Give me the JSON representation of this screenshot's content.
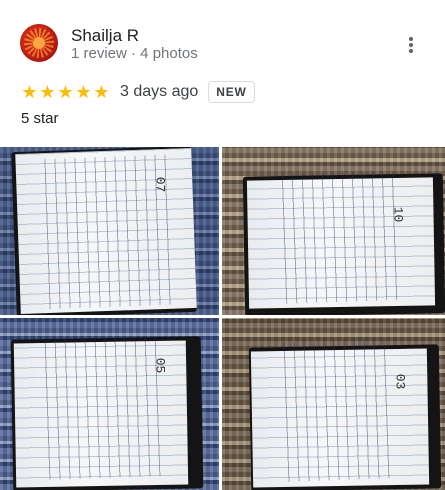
{
  "reviewer": {
    "name": "Shailja R",
    "stats": "1 review · 4 photos",
    "avatar_icon": "avatar-photo-icon"
  },
  "menu": {
    "icon": "more-vert-icon"
  },
  "rating": {
    "stars": 5,
    "max_stars": 5,
    "star_color": "#fbbc04",
    "time": "3 days ago",
    "badge": "NEW"
  },
  "review_text": "5 star",
  "photos": [
    {
      "page_number": "07"
    },
    {
      "page_number": "10"
    },
    {
      "page_number": "05"
    },
    {
      "page_number": "03"
    }
  ]
}
